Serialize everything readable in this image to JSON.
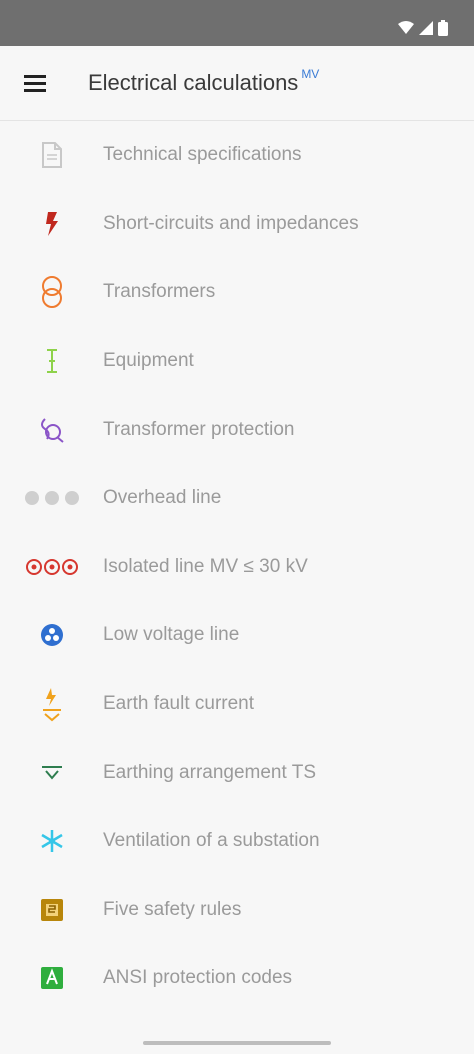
{
  "app_bar": {
    "title": "Electrical calculations",
    "title_superscript": "MV"
  },
  "menu_items": [
    {
      "label": "Technical specifications",
      "icon": "document-icon",
      "color": "#c8c8c8"
    },
    {
      "label": "Short-circuits and impedances",
      "icon": "lightning-icon",
      "color": "#c0281e"
    },
    {
      "label": "Transformers",
      "icon": "transformer-icon",
      "color": "#ef7b2f"
    },
    {
      "label": "Equipment",
      "icon": "equipment-icon",
      "color": "#8ed24a"
    },
    {
      "label": "Transformer protection",
      "icon": "transformer-protection-icon",
      "color": "#8b55c8"
    },
    {
      "label": "Overhead line",
      "icon": "overhead-line-icon",
      "color": "#cfcfcf"
    },
    {
      "label": "Isolated line MV ≤ 30 kV",
      "icon": "isolated-line-icon",
      "color": "#d6372f"
    },
    {
      "label": "Low voltage line",
      "icon": "low-voltage-line-icon",
      "color": "#2f6fd0"
    },
    {
      "label": "Earth fault current",
      "icon": "earth-fault-icon",
      "color": "#f0a21c"
    },
    {
      "label": "Earthing arrangement TS",
      "icon": "earthing-icon",
      "color": "#2e7d4f"
    },
    {
      "label": "Ventilation of a substation",
      "icon": "ventilation-icon",
      "color": "#35c6e8"
    },
    {
      "label": "Five safety rules",
      "icon": "safety-rules-icon",
      "color": "#b8860b"
    },
    {
      "label": "ANSI protection codes",
      "icon": "ansi-codes-icon",
      "color": "#2fae3e"
    }
  ]
}
